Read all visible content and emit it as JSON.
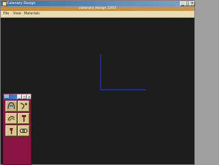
{
  "window": {
    "title": "Catenary Design"
  },
  "document": {
    "title": "catenary design 1001"
  },
  "menu": {
    "items": [
      {
        "label": "File"
      },
      {
        "label": "View"
      },
      {
        "label": "Materials"
      }
    ]
  },
  "palette": {
    "tools": [
      {
        "icon": "catenary-arch-icon"
      },
      {
        "icon": "curve-icon"
      },
      {
        "icon": "rope-coil-icon"
      },
      {
        "icon": "hammer-icon"
      },
      {
        "icon": "pin-icon"
      },
      {
        "icon": "chain-link-icon"
      }
    ]
  },
  "colors": {
    "canvas": "#1c1c1c",
    "curve": "#1f2dbf",
    "palette": "#8a1544",
    "title_gradient_start": "#3a6ea5",
    "menubar": "#e7dcb2"
  }
}
